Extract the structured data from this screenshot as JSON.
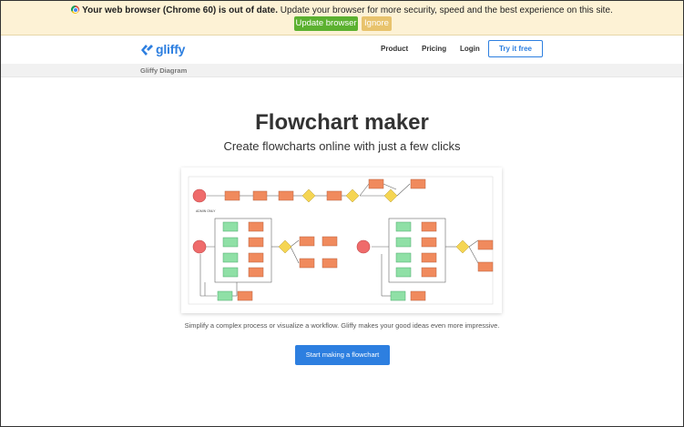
{
  "browser_warning": {
    "bold_text": "Your web browser (Chrome 60) is out of date.",
    "text": " Update your browser for more security, speed and the best experience on this site.",
    "update_label": "Update browser",
    "ignore_label": "Ignore"
  },
  "nav": {
    "logo_text": "gliffy",
    "items": [
      {
        "label": "Product"
      },
      {
        "label": "Pricing"
      },
      {
        "label": "Login"
      }
    ],
    "cta_label": "Try it free"
  },
  "breadcrumb": {
    "label": "Gliffy Diagram"
  },
  "hero": {
    "title": "Flowchart maker",
    "subtitle": "Create flowcharts online with just a few clicks",
    "diagram_label": "ADMIN ONLY",
    "tagline": "Simplify a complex process or visualize a workflow. Gliffy makes your good ideas even more impressive.",
    "cta_label": "Start making a flowchart"
  },
  "colors": {
    "accent": "#2d7fe0",
    "update_green": "#5cb130",
    "ignore_amber": "#e8c36d",
    "warning_bg": "#fdf2d5",
    "node_red": "#ef6b6b",
    "node_orange": "#f08a5d",
    "node_yellow": "#f5d552",
    "node_green": "#8fe0a6"
  }
}
